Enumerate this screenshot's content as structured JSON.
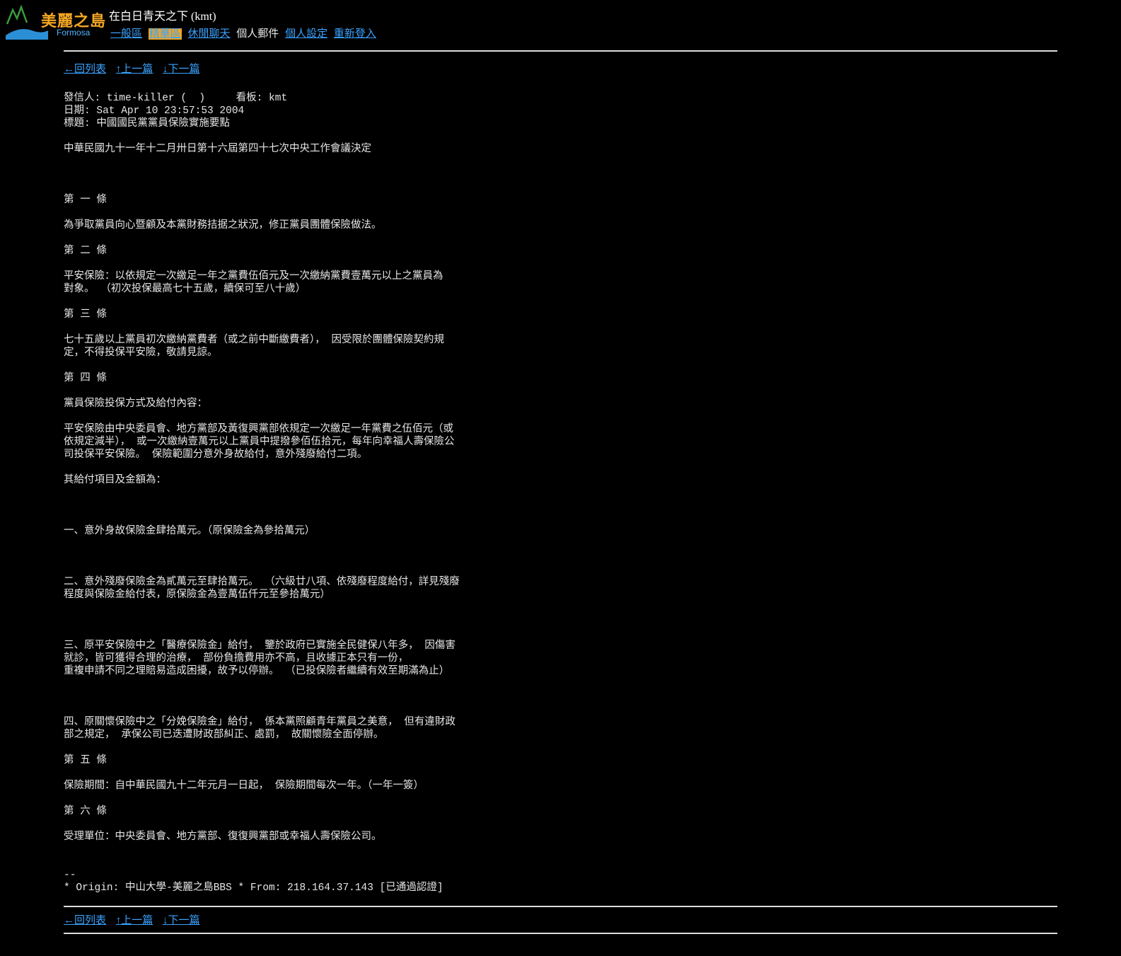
{
  "header": {
    "logo_cn": "美麗之島",
    "logo_en": "Formosa",
    "site_title": "在白日青天之下 (kmt)",
    "nav": [
      {
        "label": "一般區",
        "type": "link"
      },
      {
        "label": "精華區",
        "type": "active"
      },
      {
        "label": "休閒聊天",
        "type": "link"
      },
      {
        "label": "個人郵件",
        "type": "plain"
      },
      {
        "label": "個人設定",
        "type": "link"
      },
      {
        "label": "重新登入",
        "type": "link"
      }
    ]
  },
  "navlinks": {
    "back": "←回列表",
    "prev": "↑上一篇",
    "next": "↓下一篇"
  },
  "article": {
    "lines": [
      "發信人: time-killer (  )     看板: kmt",
      "日期: Sat Apr 10 23:57:53 2004",
      "標題: 中國國民黨黨員保險實施要點",
      "",
      "中華民國九十一年十二月卅日第十六屆第四十七次中央工作會議決定",
      "",
      "",
      "",
      "第 一 條",
      "",
      "為爭取黨員向心暨顧及本黨財務拮据之狀況，修正黨員團體保險做法。",
      "",
      "第 二 條",
      "",
      "平安保險：以依規定一次繳足一年之黨費伍佰元及一次繳納黨費壹萬元以上之黨員為",
      "對象。 （初次投保最高七十五歲，續保可至八十歲）",
      "",
      "第 三 條",
      "",
      "七十五歲以上黨員初次繳納黨費者（或之前中斷繳費者）， 因受限於團體保險契約規",
      "定，不得投保平安險，敬請見諒。",
      "",
      "第 四 條",
      "",
      "黨員保險投保方式及給付內容：",
      "",
      "平安保險由中央委員會、地方黨部及黃復興黨部依規定一次繳足一年黨費之伍佰元（或",
      "依規定減半）， 或一次繳納壹萬元以上黨員中提撥參佰伍拾元，每年向幸福人壽保險公",
      "司投保平安保險。 保險範圍分意外身故給付，意外殘廢給付二項。",
      "",
      "其給付項目及金額為：",
      "",
      "",
      "",
      "一、意外身故保險金肆拾萬元。（原保險金為參拾萬元）",
      "",
      "",
      "",
      "二、意外殘廢保險金為貳萬元至肆拾萬元。 （六級廿八項、依殘廢程度給付，詳見殘廢",
      "程度與保險金給付表，原保險金為壹萬伍仟元至參拾萬元）",
      "",
      "",
      "",
      "三、原平安保險中之「醫療保險金」給付， 鑒於政府已實施全民健保八年多， 因傷害",
      "就診，皆可獲得合理的治療， 部份負擔費用亦不高，且收據正本只有一份，",
      "重複申請不同之理賠易造成困擾，故予以停辦。 （已投保險者繼續有效至期滿為止）",
      "",
      "",
      "",
      "四、原關懷保險中之「分娩保險金」給付， 係本黨照顧青年黨員之美意， 但有違財政",
      "部之規定， 承保公司已迭遭財政部糾正、處罰， 故關懷險全面停辦。",
      "",
      "第 五 條",
      "",
      "保險期間：自中華民國九十二年元月一日起， 保險期間每次一年。（一年一簽）",
      "",
      "第 六 條",
      "",
      "受理單位：中央委員會、地方黨部、復復興黨部或幸福人壽保險公司。",
      "",
      "",
      "--",
      "* Origin: 中山大學-美麗之島BBS * From: 218.164.37.143 [已通過認證]"
    ]
  }
}
